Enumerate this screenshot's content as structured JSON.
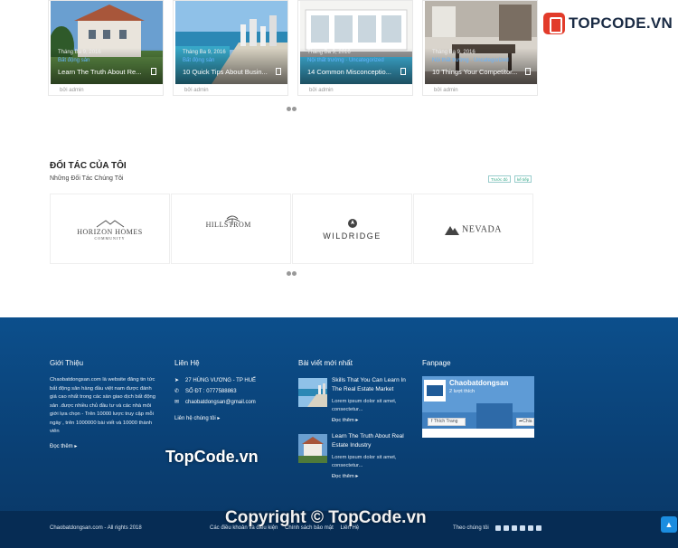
{
  "posts_carousel": {
    "cards": [
      {
        "date": "Tháng Ba 9, 2016",
        "category": "Bất động sản",
        "title": "Learn The Truth About Re...",
        "author": "bởi admin"
      },
      {
        "date": "Tháng Ba 9, 2016",
        "category": "Bất động sản",
        "title": "10 Quick Tips About Busin...",
        "author": "bởi admin"
      },
      {
        "date": "Tháng Ba 9, 2016",
        "category": "Nội thất trường · Uncategorized",
        "title": "14 Common Misconceptio...",
        "author": "bởi admin"
      },
      {
        "date": "Tháng Ba 9, 2016",
        "category": "Nội thất trường · Uncategorized",
        "title": "10 Things Your Competitor...",
        "author": "bởi admin"
      }
    ]
  },
  "brand_watermark": {
    "text": "TOPCODE.VN"
  },
  "partners": {
    "title": "ĐỐI TÁC CỦA TÔI",
    "subtitle": "Những Đối Tác Chúng Tôi",
    "prev_label": "Trước đó",
    "next_label": "kế tiếp",
    "logos": [
      {
        "name": "HORIZON HOMES",
        "sub": "COMMUNITY"
      },
      {
        "name": "HILLSTROM",
        "sub": ""
      },
      {
        "name": "WILDRIDGE",
        "sub": ""
      },
      {
        "name": "NEVADA",
        "sub": ""
      }
    ]
  },
  "footer": {
    "about": {
      "title": "Giới Thiệu",
      "text": "Chaobatdongsan.com là website đăng tin tức bất động sản hàng đầu việt nam được đánh giá cao nhất trong các sàn giao dịch bất động sản .được nhiều chủ đầu tư và các nhà môi giới lựa chọn - Trên 10000 lược truy cập mỗi ngày , trên 1000000 bài viết và 10000 thành viên",
      "more": "Đọc thêm ▸"
    },
    "contact": {
      "title": "Liên Hệ",
      "address": "27 HÙNG VƯƠNG - TP HUẾ",
      "phone": "SỐ ĐT : 0777588863",
      "email": "chaobatdongsan@gmail.com",
      "link": "Liên hệ chúng tôi ▸"
    },
    "latest": {
      "title": "Bài viết mới nhất",
      "posts": [
        {
          "title": "Skills That You Can Learn In The Real Estate Market",
          "excerpt": "Lorem ipsum dolor sit amet, consectetur...",
          "more": "Đọc thêm ▸"
        },
        {
          "title": "Learn The Truth About Real Estate Industry",
          "excerpt": "Lorem ipsum dolor sit amet, consectetur...",
          "more": "Đọc thêm ▸"
        }
      ]
    },
    "fanpage": {
      "title": "Fanpage",
      "page_name": "Chaobatdongsan",
      "likes": "2 lượt thích",
      "like_button": "Thích Trang",
      "share_button": "Chia"
    },
    "watermark_mid": "TopCode.vn"
  },
  "bottom_bar": {
    "copyright": "Chaobatdongsan.com - All rights 2018",
    "links": [
      "Các điều khoản và điều kiện",
      "Chính sách bảo mật",
      "Liên Hệ"
    ],
    "follow": "Theo chúng tôi",
    "watermark": "Copyright © TopCode.vn",
    "social_icons": [
      "facebook-icon",
      "twitter-icon",
      "youtube-icon",
      "linkedin-icon",
      "instagram-icon",
      "skype-icon"
    ]
  },
  "colors": {
    "footer_bg": "#0c4f8c",
    "bottom_bar_bg": "#062c54",
    "accent": "#1b8de0"
  }
}
